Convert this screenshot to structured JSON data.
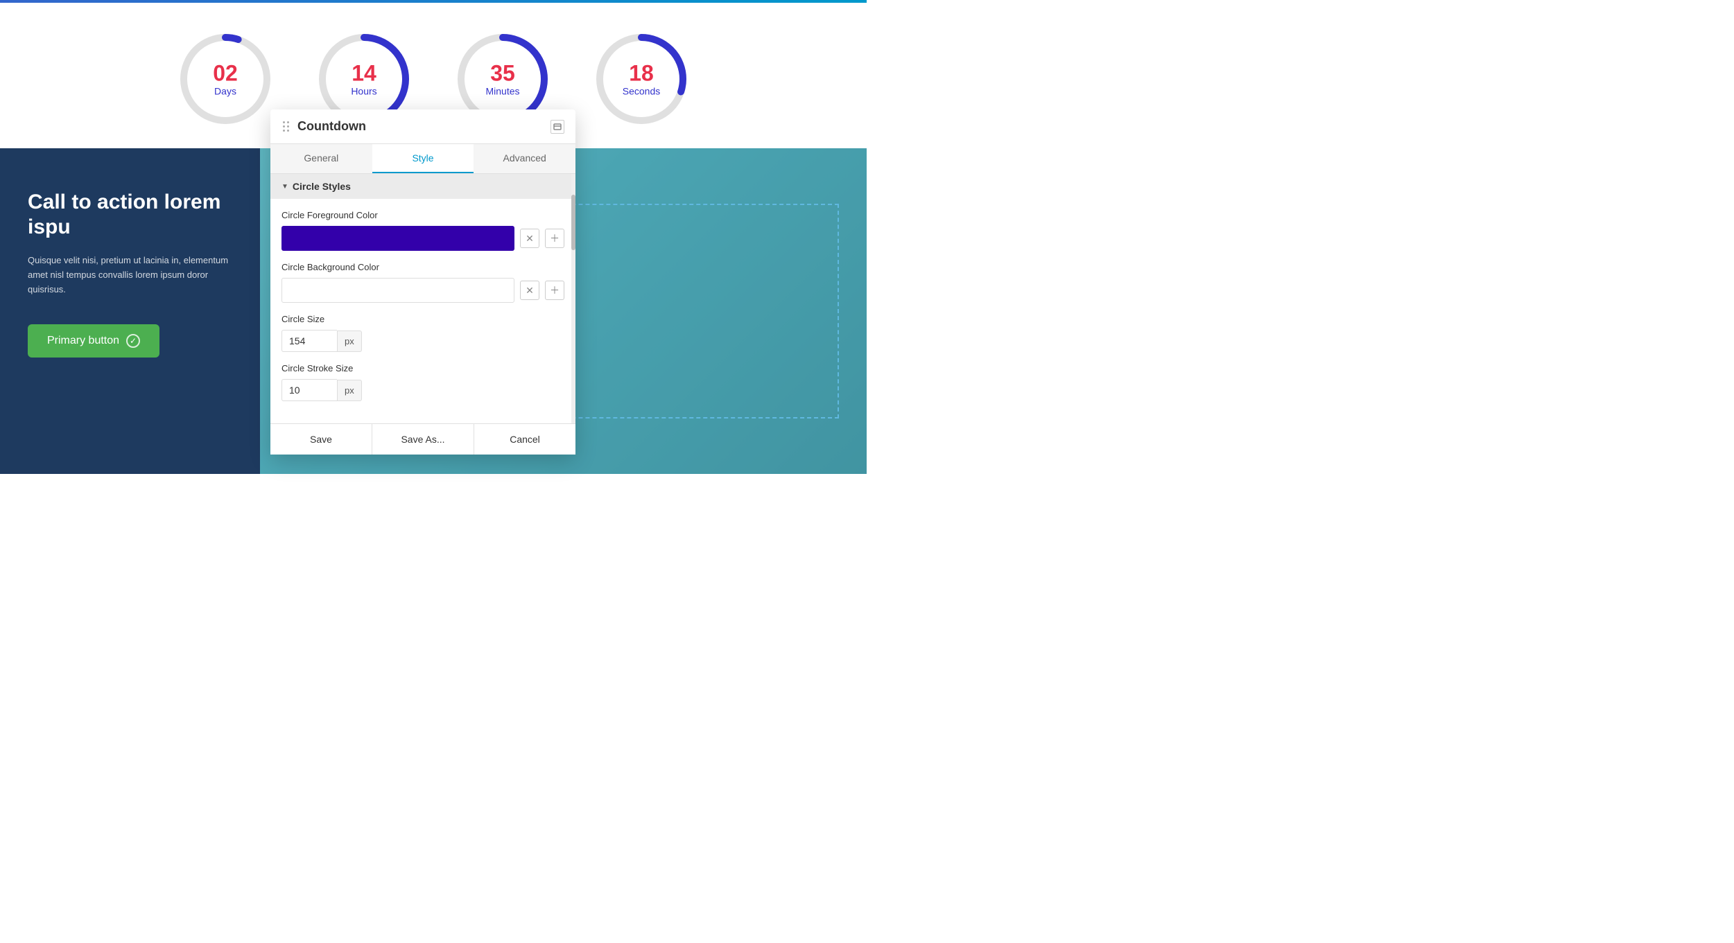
{
  "topAccent": true,
  "countdown": {
    "items": [
      {
        "value": "02",
        "label": "Days",
        "progress": 5,
        "color": "#3333cc"
      },
      {
        "value": "14",
        "label": "Hours",
        "progress": 58,
        "color": "#3333cc"
      },
      {
        "value": "35",
        "label": "Minutes",
        "progress": 58,
        "color": "#3333cc"
      },
      {
        "value": "18",
        "label": "Seconds",
        "progress": 30,
        "color": "#3333cc"
      }
    ]
  },
  "cta": {
    "title": "Call to action lorem ispu",
    "text": "Quisque velit nisi, pretium ut lacinia in, elementum amet nisl tempus convallis lorem ipsum doror quisrisus.",
    "buttonLabel": "Primary button"
  },
  "modal": {
    "title": "Countdown",
    "tabs": [
      {
        "label": "General",
        "active": false
      },
      {
        "label": "Style",
        "active": true
      },
      {
        "label": "Advanced",
        "active": false
      }
    ],
    "sections": [
      {
        "label": "Circle Styles",
        "expanded": true,
        "fields": [
          {
            "type": "color",
            "label": "Circle Foreground Color",
            "value": "#3300aa",
            "hasValue": true
          },
          {
            "type": "color",
            "label": "Circle Background Color",
            "value": "",
            "hasValue": false
          },
          {
            "type": "input",
            "label": "Circle Size",
            "value": "154",
            "unit": "px"
          },
          {
            "type": "input",
            "label": "Circle Stroke Size",
            "value": "10",
            "unit": "px"
          }
        ]
      }
    ],
    "footer": {
      "saveLabel": "Save",
      "saveAsLabel": "Save As...",
      "cancelLabel": "Cancel"
    }
  }
}
